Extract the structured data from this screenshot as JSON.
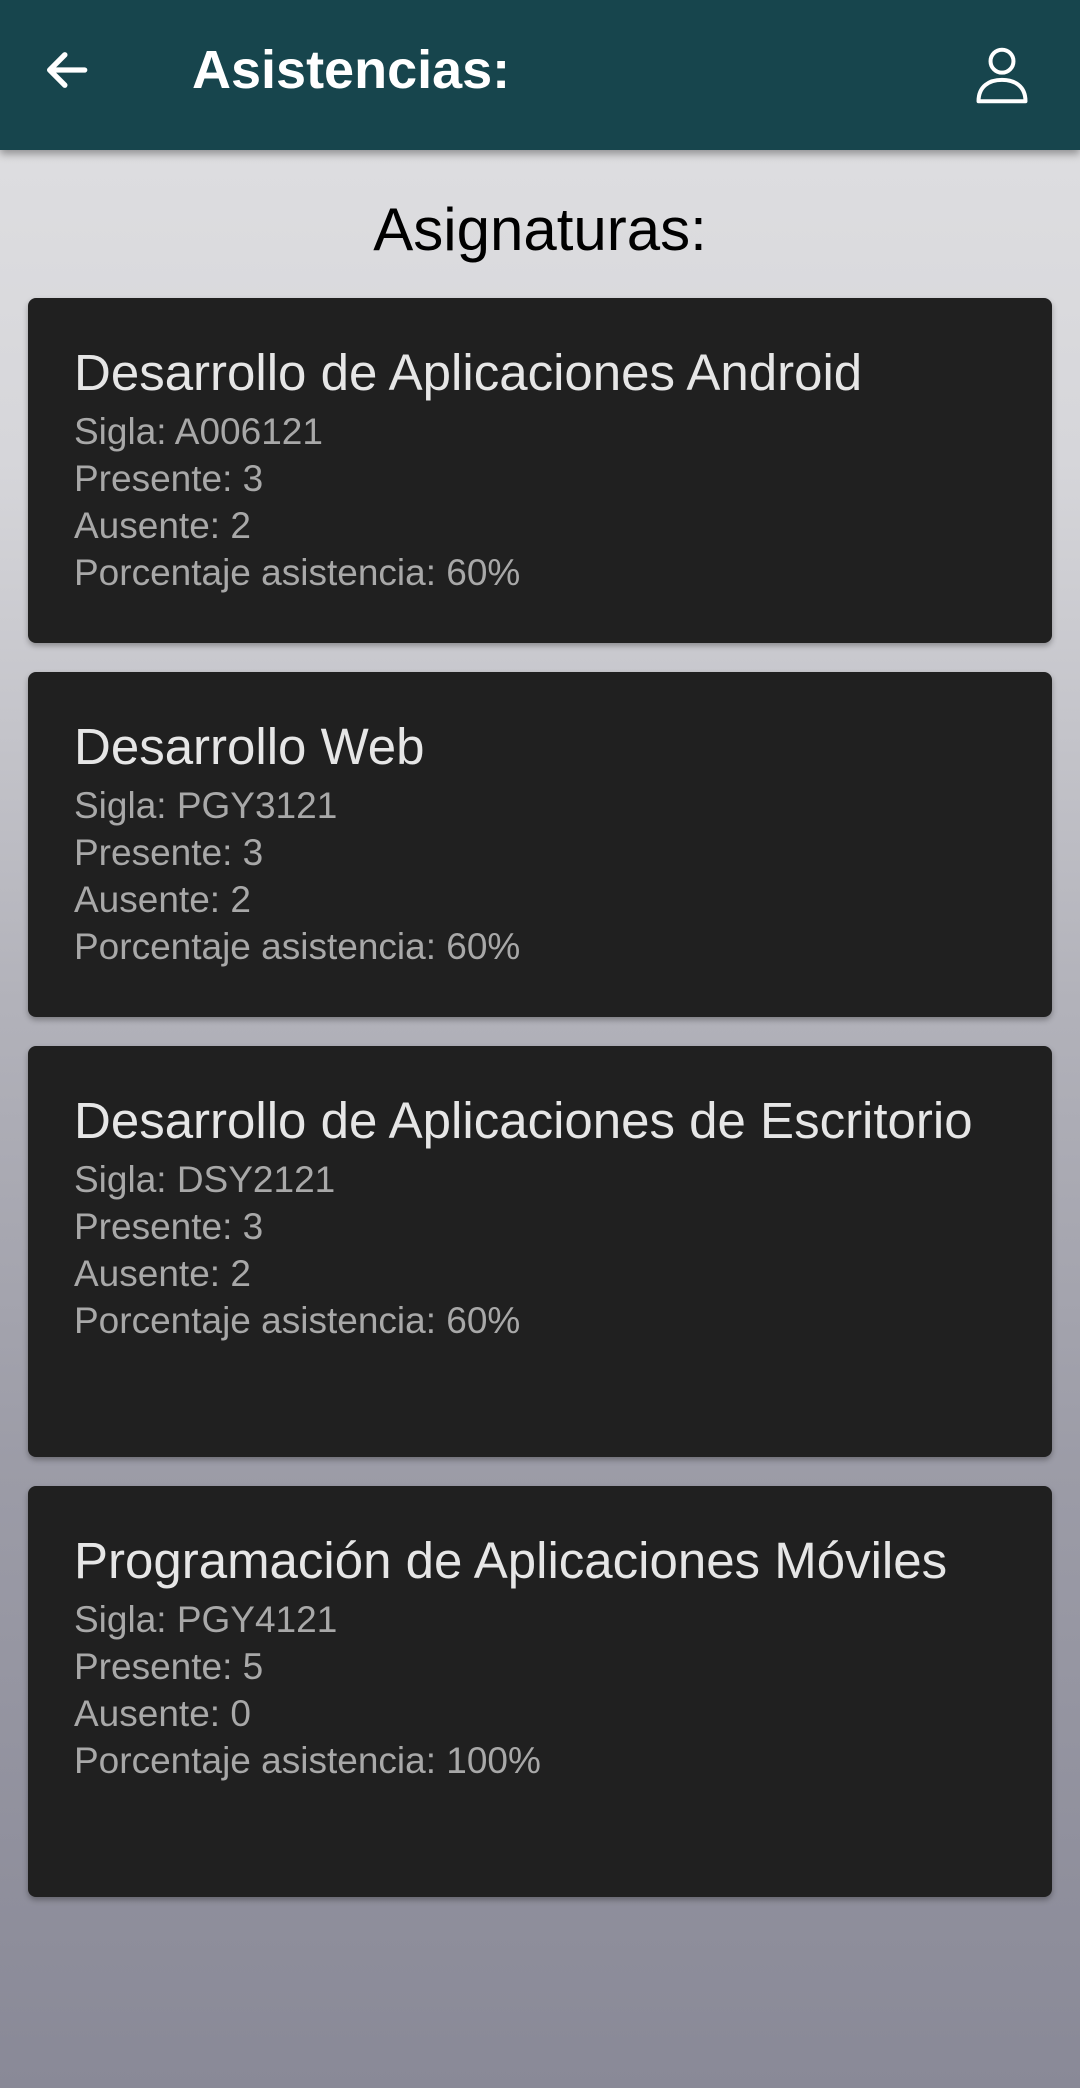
{
  "toolbar": {
    "title": "Asistencias:",
    "back_icon": "arrow-back-icon",
    "profile_icon": "person-outline-icon",
    "background_color": "#17454d"
  },
  "main": {
    "section_title": "Asignaturas:",
    "courses": [
      {
        "name": "Desarrollo de Aplicaciones Android",
        "code_line": "Sigla: A006121",
        "present_line": "Presente: 3",
        "absent_line": "Ausente: 2",
        "percent_line": "Porcentaje asistencia: 60%"
      },
      {
        "name": "Desarrollo Web",
        "code_line": "Sigla: PGY3121",
        "present_line": "Presente: 3",
        "absent_line": "Ausente: 2",
        "percent_line": "Porcentaje asistencia: 60%"
      },
      {
        "name": "Desarrollo de Aplicaciones de Escritorio",
        "code_line": "Sigla: DSY2121",
        "present_line": "Presente: 3",
        "absent_line": "Ausente: 2",
        "percent_line": "Porcentaje asistencia: 60%"
      },
      {
        "name": "Programación de Aplicaciones Móviles",
        "code_line": "Sigla: PGY4121",
        "present_line": "Presente: 5",
        "absent_line": "Ausente: 0",
        "percent_line": "Porcentaje asistencia: 100%"
      }
    ]
  }
}
